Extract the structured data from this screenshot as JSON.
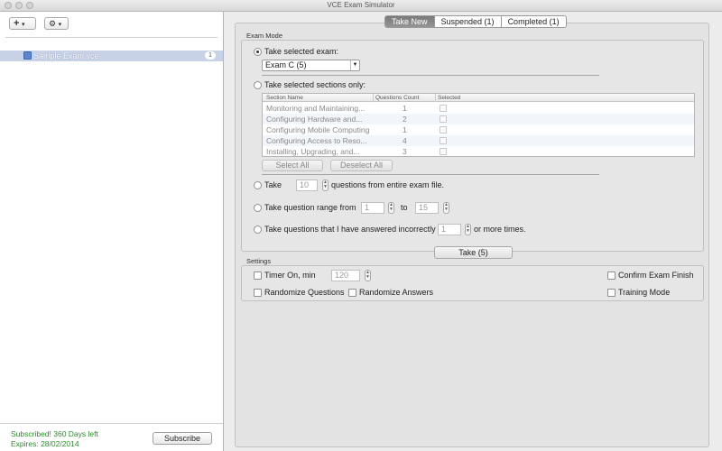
{
  "window": {
    "title": "VCE Exam Simulator"
  },
  "toolbar": {
    "add_label": "+",
    "add_menu_caret": "▾",
    "gear_label": "⚙",
    "gear_menu_caret": "▾"
  },
  "sidebar": {
    "items": [
      {
        "label": "Sample Exam.vce",
        "badge": "1"
      }
    ],
    "subscription_status": "Subscribed! 360 Days left",
    "expires": "Expires: 28/02/2014",
    "subscribe_label": "Subscribe"
  },
  "tabs": [
    {
      "label": "Take New",
      "active": true
    },
    {
      "label": "Suspended (1)",
      "active": false
    },
    {
      "label": "Completed (1)",
      "active": false
    }
  ],
  "exam_mode": {
    "group_label": "Exam Mode",
    "option_selected_exam": "Take selected exam:",
    "exam_select_value": "Exam C (5)",
    "option_sections": "Take selected sections only:",
    "table_headers": [
      "Section Name",
      "Questions Count",
      "Selected"
    ],
    "sections": [
      {
        "name": "Monitoring and Maintaining...",
        "count": "1"
      },
      {
        "name": "Configuring Hardware and...",
        "count": "2"
      },
      {
        "name": "Configuring Mobile Computing",
        "count": "1"
      },
      {
        "name": "Configuring Access to Reso...",
        "count": "4"
      },
      {
        "name": "Installing, Upgrading, and...",
        "count": "3"
      }
    ],
    "select_all": "Select All",
    "deselect_all": "Deselect All",
    "option_take": "Take",
    "take_count": "10",
    "take_suffix": "questions from entire exam file.",
    "option_range": "Take question range from",
    "range_from": "1",
    "range_to_label": "to",
    "range_to": "15",
    "option_incorrect": "Take questions that I have answered incorrectly",
    "incorrect_count": "1",
    "incorrect_suffix": "or more times."
  },
  "take_button": "Take (5)",
  "settings": {
    "group_label": "Settings",
    "timer_label": "Timer On, min",
    "timer_value": "120",
    "confirm_finish": "Confirm Exam Finish",
    "randomize_questions": "Randomize Questions",
    "randomize_answers": "Randomize Answers",
    "training_mode": "Training Mode"
  }
}
